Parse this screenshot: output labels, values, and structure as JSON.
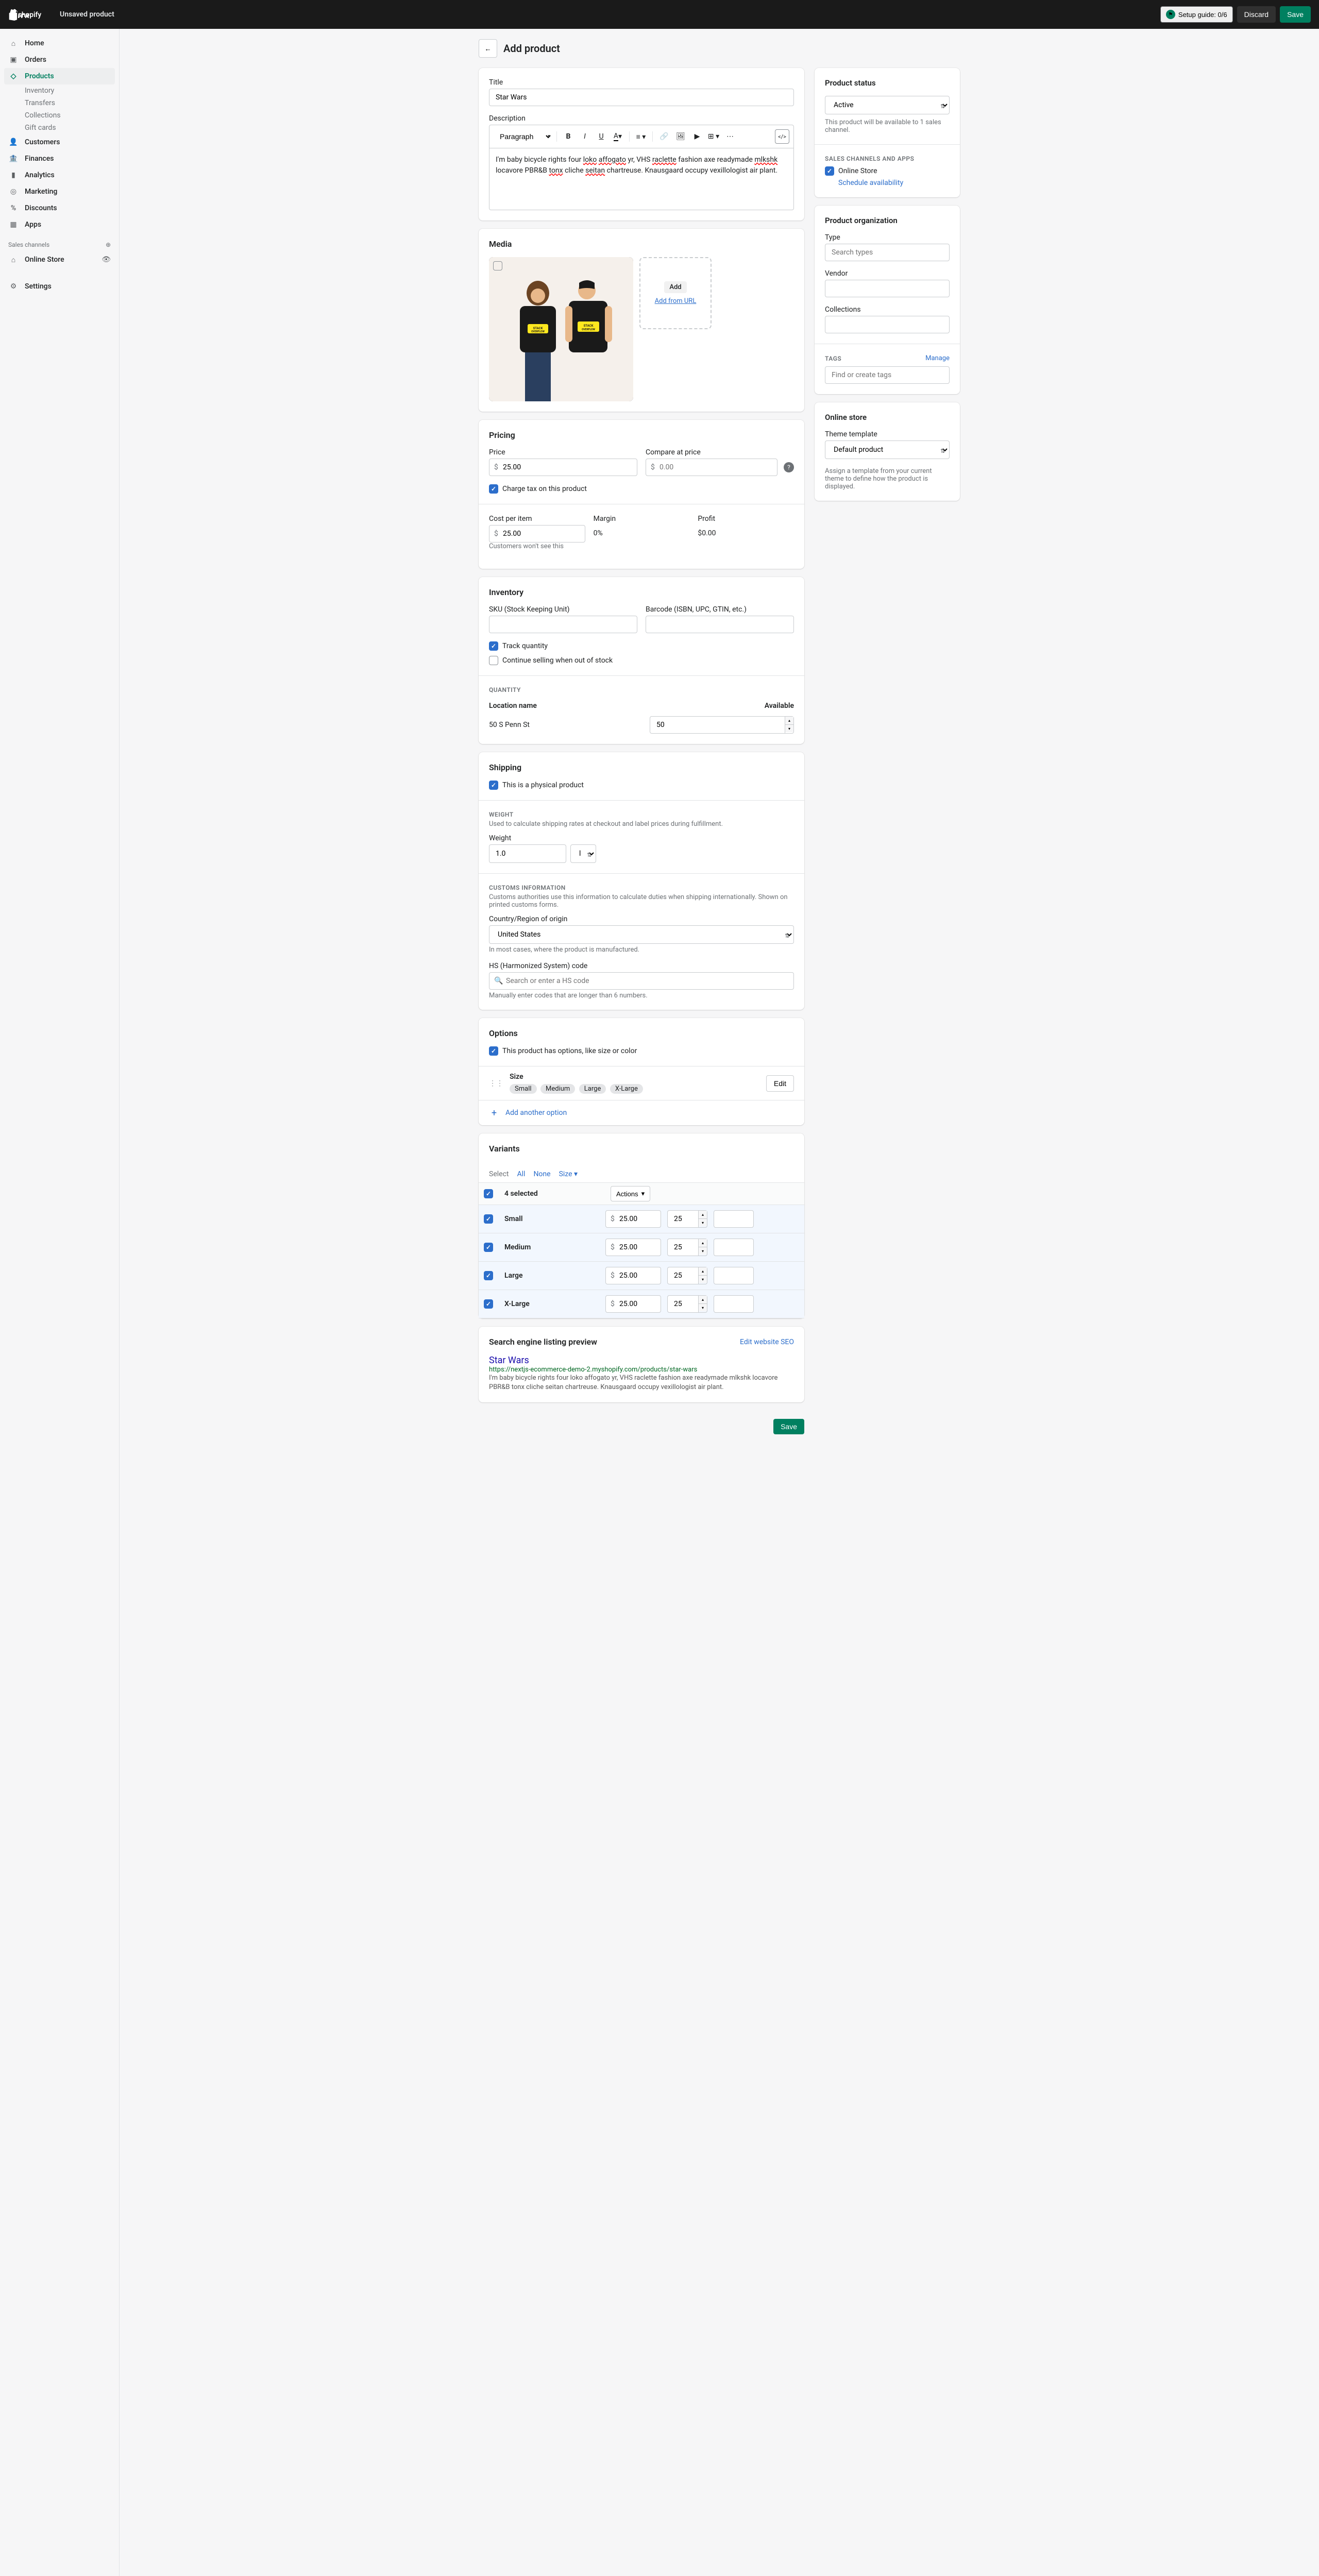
{
  "topbar": {
    "title": "Unsaved product",
    "setup_guide": "Setup guide: 0/6",
    "discard": "Discard",
    "save": "Save"
  },
  "sidebar": {
    "items": [
      {
        "label": "Home",
        "icon": "home"
      },
      {
        "label": "Orders",
        "icon": "orders"
      },
      {
        "label": "Products",
        "icon": "products",
        "active": true,
        "sub": [
          {
            "label": "Inventory"
          },
          {
            "label": "Transfers"
          },
          {
            "label": "Collections"
          },
          {
            "label": "Gift cards"
          }
        ]
      },
      {
        "label": "Customers",
        "icon": "customers"
      },
      {
        "label": "Finances",
        "icon": "finances"
      },
      {
        "label": "Analytics",
        "icon": "analytics"
      },
      {
        "label": "Marketing",
        "icon": "marketing"
      },
      {
        "label": "Discounts",
        "icon": "discounts"
      },
      {
        "label": "Apps",
        "icon": "apps"
      }
    ],
    "channels_label": "Sales channels",
    "online_store": "Online Store",
    "settings": "Settings"
  },
  "page": {
    "title": "Add product"
  },
  "product": {
    "title_label": "Title",
    "title_value": "Star Wars",
    "description_label": "Description",
    "toolbar_paragraph": "Paragraph",
    "description_value": "I'm baby bicycle rights four loko affogato yr, VHS raclette fashion axe readymade mlkshk locavore PBR&B tonx cliche seitan chartreuse. Knausgaard occupy vexillologist air plant."
  },
  "media": {
    "heading": "Media",
    "add": "Add",
    "add_from_url": "Add from URL"
  },
  "pricing": {
    "heading": "Pricing",
    "price_label": "Price",
    "price_value": "25.00",
    "compare_label": "Compare at price",
    "compare_placeholder": "0.00",
    "tax_label": "Charge tax on this product",
    "cost_label": "Cost per item",
    "cost_value": "25.00",
    "cost_help": "Customers won't see this",
    "margin_label": "Margin",
    "margin_value": "0%",
    "profit_label": "Profit",
    "profit_value": "$0.00"
  },
  "inventory": {
    "heading": "Inventory",
    "sku_label": "SKU (Stock Keeping Unit)",
    "barcode_label": "Barcode (ISBN, UPC, GTIN, etc.)",
    "track_label": "Track quantity",
    "continue_label": "Continue selling when out of stock",
    "quantity_heading": "QUANTITY",
    "location_label": "Location name",
    "available_label": "Available",
    "location_value": "50 S Penn St",
    "quantity_value": "50"
  },
  "shipping": {
    "heading": "Shipping",
    "physical_label": "This is a physical product",
    "weight_heading": "WEIGHT",
    "weight_help": "Used to calculate shipping rates at checkout and label prices during fulfillment.",
    "weight_label": "Weight",
    "weight_value": "1.0",
    "weight_unit": "lb",
    "customs_heading": "CUSTOMS INFORMATION",
    "customs_help": "Customs authorities use this information to calculate duties when shipping internationally. Shown on printed customs forms.",
    "country_label": "Country/Region of origin",
    "country_value": "United States",
    "country_help": "In most cases, where the product is manufactured.",
    "hs_label": "HS (Harmonized System) code",
    "hs_placeholder": "Search or enter a HS code",
    "hs_help": "Manually enter codes that are longer than 6 numbers."
  },
  "options": {
    "heading": "Options",
    "has_options_label": "This product has options, like size or color",
    "size_label": "Size",
    "size_values": [
      "Small",
      "Medium",
      "Large",
      "X-Large"
    ],
    "edit": "Edit",
    "add_another": "Add another option"
  },
  "variants": {
    "heading": "Variants",
    "select_label": "Select",
    "all": "All",
    "none": "None",
    "size": "Size",
    "selected_count": "4 selected",
    "actions": "Actions",
    "rows": [
      {
        "name": "Small",
        "price": "25.00",
        "qty": "25"
      },
      {
        "name": "Medium",
        "price": "25.00",
        "qty": "25"
      },
      {
        "name": "Large",
        "price": "25.00",
        "qty": "25"
      },
      {
        "name": "X-Large",
        "price": "25.00",
        "qty": "25"
      }
    ]
  },
  "seo": {
    "heading": "Search engine listing preview",
    "edit_link": "Edit website SEO",
    "title": "Star Wars",
    "url": "https://nextjs-ecommerce-demo-2.myshopify.com/products/star-wars",
    "desc": "I'm baby bicycle rights four loko affogato yr, VHS raclette fashion axe readymade mlkshk locavore PBR&B tonx cliche seitan chartreuse. Knausgaard occupy vexillologist air plant."
  },
  "status": {
    "heading": "Product status",
    "value": "Active",
    "help": "This product will be available to 1 sales channel.",
    "channels_heading": "SALES CHANNELS AND APPS",
    "online_store": "Online Store",
    "schedule": "Schedule availability"
  },
  "organization": {
    "heading": "Product organization",
    "type_label": "Type",
    "type_placeholder": "Search types",
    "vendor_label": "Vendor",
    "collections_label": "Collections",
    "tags_label": "TAGS",
    "manage": "Manage",
    "tags_placeholder": "Find or create tags"
  },
  "online_store": {
    "heading": "Online store",
    "template_label": "Theme template",
    "template_value": "Default product",
    "help": "Assign a template from your current theme to define how the product is displayed."
  },
  "footer_save": "Save"
}
